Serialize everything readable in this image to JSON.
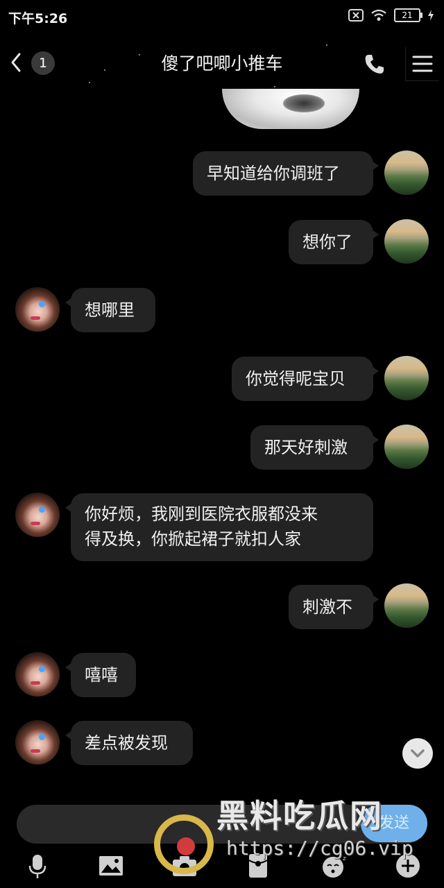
{
  "status_bar": {
    "time": "下午5:26",
    "battery": "21"
  },
  "header": {
    "title": "傻了吧唧小推车",
    "unread_count": "1"
  },
  "messages": [
    {
      "side": "right",
      "text": "早知道给你调班了"
    },
    {
      "side": "right",
      "text": "想你了"
    },
    {
      "side": "left",
      "text": "想哪里"
    },
    {
      "side": "right",
      "text": "你觉得呢宝贝"
    },
    {
      "side": "right",
      "text": "那天好刺激"
    },
    {
      "side": "left",
      "lines": [
        "你好烦，我刚到医院衣服都没来",
        "得及换，你掀起裙子就扣人家"
      ]
    },
    {
      "side": "right",
      "text": "刺激不"
    },
    {
      "side": "left",
      "text": "嘻嘻"
    },
    {
      "side": "left",
      "text": "差点被发现"
    }
  ],
  "input_bar": {
    "send_label": "发送"
  },
  "toolbar": {
    "icons": [
      "microphone-icon",
      "image-icon",
      "camera-icon",
      "red-packet-icon",
      "emoji-icon",
      "plus-icon"
    ]
  },
  "watermark": {
    "title": "黑料吃瓜网",
    "url": "https://cg06.vip"
  }
}
